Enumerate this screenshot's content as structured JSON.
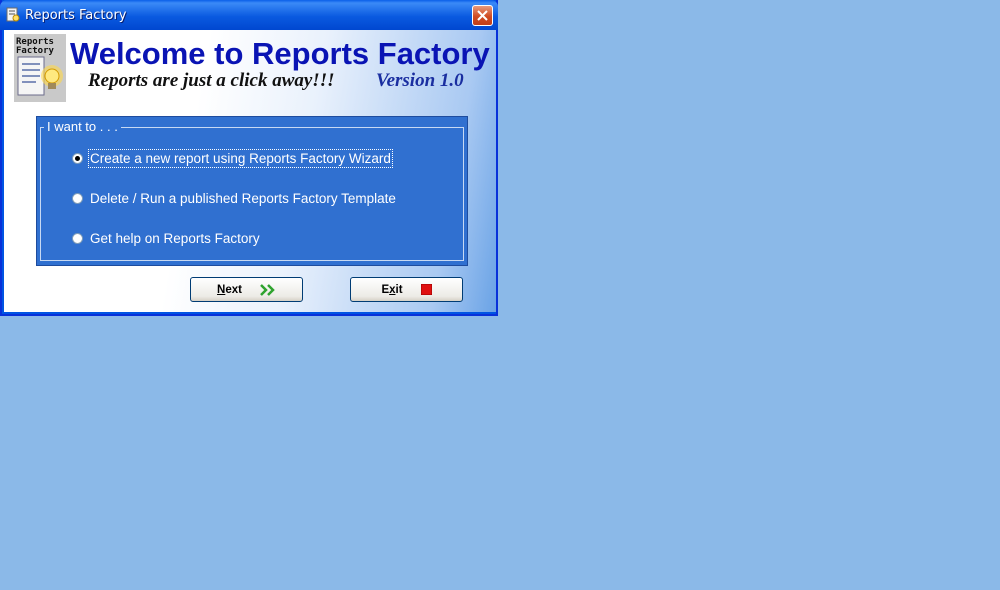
{
  "window": {
    "title": "Reports Factory"
  },
  "header": {
    "logo_text": "Reports Factory",
    "welcome": "Welcome to Reports Factory",
    "tagline": "Reports are just a click away!!!",
    "version": "Version 1.0"
  },
  "options": {
    "legend": "I want to . . .",
    "items": [
      {
        "label": "Create a new report using Reports Factory Wizard",
        "checked": true
      },
      {
        "label": "Delete / Run a published Reports Factory Template",
        "checked": false
      },
      {
        "label": "Get help on Reports Factory",
        "checked": false
      }
    ]
  },
  "buttons": {
    "next_mnemonic": "N",
    "next_rest": "ext",
    "next_icon": "double-chevron-right-icon",
    "exit_first": "E",
    "exit_mnemonic": "x",
    "exit_rest": "it",
    "exit_icon": "red-stop-square-icon"
  },
  "colors": {
    "desktop": "#8bb9e8",
    "title_blue": "#0a14b4",
    "group_blue": "#3070d0"
  }
}
